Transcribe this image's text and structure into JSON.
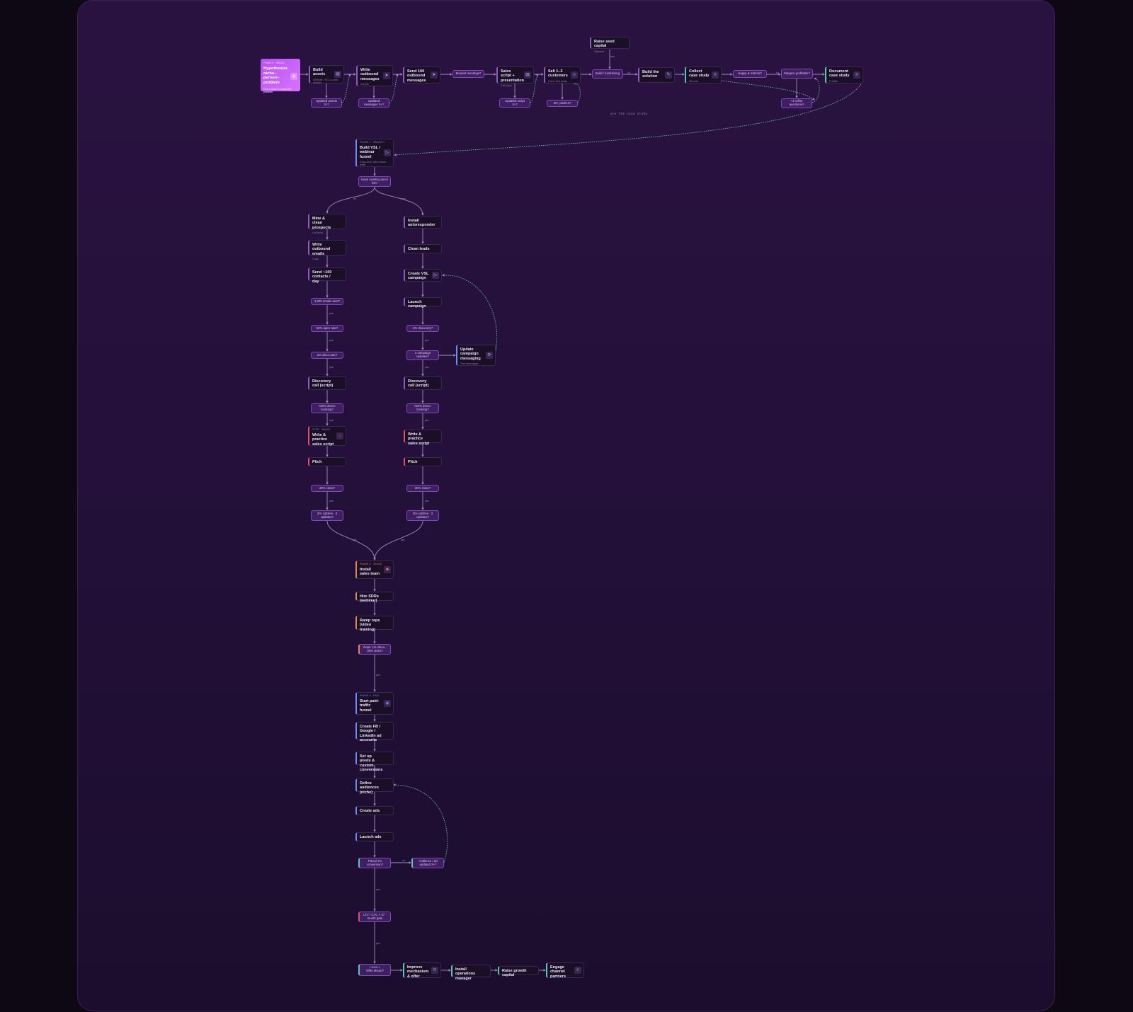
{
  "start": {
    "tag": "PHASE 0 · SINGLE",
    "title": "Hypothesize niche–person–problem",
    "sub": "Pick a niche & define the problem",
    "icon": "target-icon"
  },
  "top_row": [
    {
      "id": "build-assets",
      "title": "Build assets",
      "sub": "Website, VSL & case studies",
      "icon": "document-icon"
    },
    {
      "id": "write-outbound",
      "title": "Write outbound messages",
      "sub": "Scripts",
      "icon": "send-icon"
    },
    {
      "id": "send-100",
      "title": "Send 100 outbound messages",
      "sub": "",
      "icon": "send-icon"
    },
    {
      "id": "sales-script",
      "title": "Sales script + presentation",
      "sub": "Call deck",
      "icon": "document-icon"
    },
    {
      "id": "sell-1-3",
      "title": "Sell 1–3 customers",
      "sub": "Close first deals",
      "icon": "user-plus-icon"
    },
    {
      "id": "build-solution",
      "title": "Build the solution",
      "sub": "",
      "icon": "wrench-icon"
    },
    {
      "id": "collect-case",
      "title": "Collect case study",
      "sub": "Results",
      "icon": "trophy-icon"
    },
    {
      "id": "document-case",
      "title": "Document case study",
      "sub": "Publish",
      "icon": "trophy-icon"
    },
    {
      "id": "raise-seed",
      "title": "Raise seed capital",
      "sub": "Optional",
      "icon": ""
    }
  ],
  "top_decisions": {
    "updated_assets": "Updated assets 3+?",
    "updated_messages": "Updated messages 3+?",
    "booked_meetings": "Booked meetings?",
    "updated_script": "Updated script 3+?",
    "pitches_30": "30+ pitches?",
    "build_fundraising": "Build / fundraising",
    "happy_referral": "Happy & referral?",
    "margins_profitable": "Margins profitable?",
    "refine_questions": "+3 refine questions?"
  },
  "top_labels": {
    "yes": "yes",
    "no": "no",
    "use_case_study": "use the case study"
  },
  "vsl": {
    "tag": "PHASE 1 · BRANCH",
    "title": "Build VSL / webinar funnel",
    "sub": "Long-form video sales letter",
    "icon": "play-icon",
    "decision": "Have existing opt-in list?",
    "no": "no",
    "yes": "yes"
  },
  "left_col": {
    "n1": "Mine & clean prospects",
    "n1_sub": "List build",
    "n2": "Write outbound emails",
    "n2_sub": "Copy",
    "n3": "Send ~100 contacts / day",
    "d1": "1,000 emails sent?",
    "d2": "50% open rate?",
    "d3": "2% disco rate?",
    "n4": "Discovery call (script)",
    "d4": "<50% demo-booking?",
    "n5_tag": "STEP · SALES",
    "n5": "Write & practice sales script",
    "n6": "Pitch",
    "d5": "30% close?",
    "d6": "20+ pitches · 3 updates?"
  },
  "right_col": {
    "n1": "Install autoresponder",
    "n2": "Clean leads",
    "n3": "Create VSL campaign",
    "n4": "Launch campaign",
    "d1": "3% discovery?",
    "d2": "3 campaign updates?",
    "n5": "Discovery call (script)",
    "d3": "<50% demo-booking?",
    "n6": "Write & practice sales script",
    "n7": "Pitch",
    "d4": "30% close?",
    "d5": "20+ pitches · 3 updates?",
    "side": "Update campaign messaging",
    "side_sub": "Test messages"
  },
  "mid_labels": {
    "yes": "yes",
    "no": "no"
  },
  "sales_team": {
    "tag": "PHASE 2 · SCALE",
    "title": "Install sales team",
    "icon": "team-icon",
    "n1": "Hire SDRs (webinar)",
    "n2": "Ramp reps (video training)",
    "d1": "Reps: 1% disco · 30% close?"
  },
  "paid": {
    "tag": "PHASE 3 · PAID",
    "title": "Start paid-traffic funnel",
    "icon": "globe-icon",
    "n1": "Create FB / Google / LinkedIn ad accounts",
    "n2": "Set up pixels & custom conversions",
    "n3": "Define audiences (niche)",
    "n4": "Create ads",
    "n5": "Launch ads",
    "d1": "Paced 1% conversion?",
    "d2": "Audience / ad updated 3+?",
    "d3": "LTV / CAC > 3? · month gate",
    "no": "no"
  },
  "bottom_row": {
    "d1_tag": "PHASE 4",
    "d1": "Offer ahead?",
    "n1": "Improve mechanism & offer",
    "n1_icon": "refresh-icon",
    "n2": "Install operations manager",
    "n3": "Raise growth capital",
    "n4": "Engage channel partners",
    "n4_icon": "trophy-icon"
  },
  "colors": {
    "accent": "#8a5cc0",
    "teal": "#56c7b8",
    "orange": "#e08a4b",
    "red": "#e0506a",
    "start": "#c562f5"
  }
}
